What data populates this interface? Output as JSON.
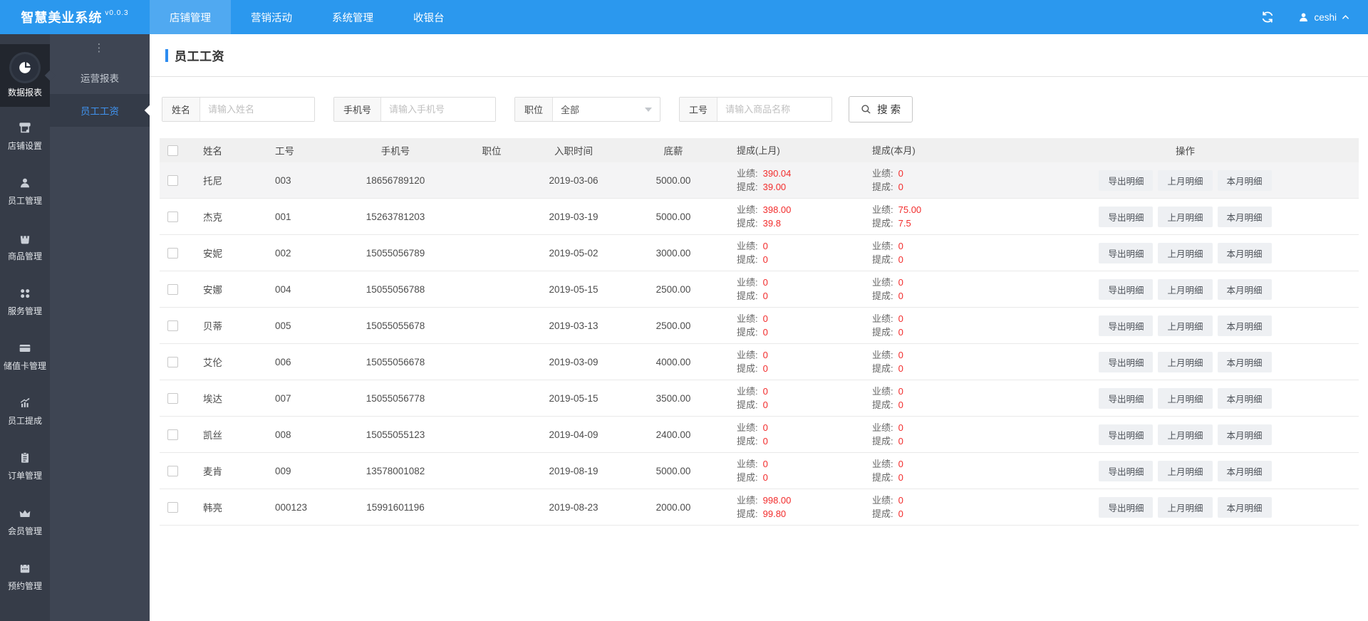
{
  "app": {
    "title": "智慧美业系统",
    "version": "v0.0.3"
  },
  "topnav": {
    "items": [
      {
        "label": "店铺管理",
        "active": true
      },
      {
        "label": "营销活动",
        "active": false
      },
      {
        "label": "系统管理",
        "active": false
      },
      {
        "label": "收银台",
        "active": false
      }
    ]
  },
  "topbar_right": {
    "username": "ceshi"
  },
  "sidebar": {
    "items": [
      {
        "label": "数据报表",
        "icon": "pie-chart-icon",
        "active": true
      },
      {
        "label": "店铺设置",
        "icon": "storefront-icon"
      },
      {
        "label": "员工管理",
        "icon": "user-icon"
      },
      {
        "label": "商品管理",
        "icon": "bag-icon"
      },
      {
        "label": "服务管理",
        "icon": "grid-dots-icon"
      },
      {
        "label": "储值卡管理",
        "icon": "card-icon"
      },
      {
        "label": "员工提成",
        "icon": "trend-chart-icon"
      },
      {
        "label": "订单管理",
        "icon": "clipboard-icon"
      },
      {
        "label": "会员管理",
        "icon": "crown-icon"
      },
      {
        "label": "预约管理",
        "icon": "calendar-icon"
      }
    ]
  },
  "submenu": {
    "dots": "⋮",
    "items": [
      {
        "label": "运营报表",
        "active": false
      },
      {
        "label": "员工工资",
        "active": true
      }
    ]
  },
  "page": {
    "title": "员工工资"
  },
  "filters": {
    "name": {
      "label": "姓名",
      "placeholder": "请输入姓名"
    },
    "phone": {
      "label": "手机号",
      "placeholder": "请输入手机号"
    },
    "position": {
      "label": "职位",
      "value": "全部"
    },
    "employee_id": {
      "label": "工号",
      "placeholder": "请输入商品名称"
    },
    "search_label": "搜 索"
  },
  "table": {
    "columns": [
      "姓名",
      "工号",
      "手机号",
      "职位",
      "入职时间",
      "底薪",
      "提成(上月)",
      "提成(本月)",
      "操作"
    ],
    "commission_labels": {
      "performance": "业绩:",
      "commission": "提成:"
    },
    "actions": [
      "导出明细",
      "上月明细",
      "本月明细"
    ],
    "rows": [
      {
        "highlighted": true,
        "name": "托尼",
        "id": "003",
        "phone": "18656789120",
        "position": "",
        "hire_date": "2019-03-06",
        "base_salary": "5000.00",
        "last_month": {
          "performance": "390.04",
          "commission": "39.00"
        },
        "this_month": {
          "performance": "0",
          "commission": "0"
        }
      },
      {
        "highlighted": false,
        "name": "杰克",
        "id": "001",
        "phone": "15263781203",
        "position": "",
        "hire_date": "2019-03-19",
        "base_salary": "5000.00",
        "last_month": {
          "performance": "398.00",
          "commission": "39.8"
        },
        "this_month": {
          "performance": "75.00",
          "commission": "7.5"
        }
      },
      {
        "highlighted": false,
        "name": "安妮",
        "id": "002",
        "phone": "15055056789",
        "position": "",
        "hire_date": "2019-05-02",
        "base_salary": "3000.00",
        "last_month": {
          "performance": "0",
          "commission": "0"
        },
        "this_month": {
          "performance": "0",
          "commission": "0"
        }
      },
      {
        "highlighted": false,
        "name": "安娜",
        "id": "004",
        "phone": "15055056788",
        "position": "",
        "hire_date": "2019-05-15",
        "base_salary": "2500.00",
        "last_month": {
          "performance": "0",
          "commission": "0"
        },
        "this_month": {
          "performance": "0",
          "commission": "0"
        }
      },
      {
        "highlighted": false,
        "name": "贝蒂",
        "id": "005",
        "phone": "15055055678",
        "position": "",
        "hire_date": "2019-03-13",
        "base_salary": "2500.00",
        "last_month": {
          "performance": "0",
          "commission": "0"
        },
        "this_month": {
          "performance": "0",
          "commission": "0"
        }
      },
      {
        "highlighted": false,
        "name": "艾伦",
        "id": "006",
        "phone": "15055056678",
        "position": "",
        "hire_date": "2019-03-09",
        "base_salary": "4000.00",
        "last_month": {
          "performance": "0",
          "commission": "0"
        },
        "this_month": {
          "performance": "0",
          "commission": "0"
        }
      },
      {
        "highlighted": false,
        "name": "埃达",
        "id": "007",
        "phone": "15055056778",
        "position": "",
        "hire_date": "2019-05-15",
        "base_salary": "3500.00",
        "last_month": {
          "performance": "0",
          "commission": "0"
        },
        "this_month": {
          "performance": "0",
          "commission": "0"
        }
      },
      {
        "highlighted": false,
        "name": "凯丝",
        "id": "008",
        "phone": "15055055123",
        "position": "",
        "hire_date": "2019-04-09",
        "base_salary": "2400.00",
        "last_month": {
          "performance": "0",
          "commission": "0"
        },
        "this_month": {
          "performance": "0",
          "commission": "0"
        }
      },
      {
        "highlighted": false,
        "name": "麦肯",
        "id": "009",
        "phone": "13578001082",
        "position": "",
        "hire_date": "2019-08-19",
        "base_salary": "5000.00",
        "last_month": {
          "performance": "0",
          "commission": "0"
        },
        "this_month": {
          "performance": "0",
          "commission": "0"
        }
      },
      {
        "highlighted": false,
        "name": "韩亮",
        "id": "000123",
        "phone": "15991601196",
        "position": "",
        "hire_date": "2019-08-23",
        "base_salary": "2000.00",
        "last_month": {
          "performance": "998.00",
          "commission": "99.80"
        },
        "this_month": {
          "performance": "0",
          "commission": "0"
        }
      }
    ]
  },
  "colors": {
    "brand_blue": "#2b98ee",
    "accent_blue": "#2d8cf0",
    "value_red": "#f22c2c",
    "sidebar_dark": "#363c48"
  }
}
